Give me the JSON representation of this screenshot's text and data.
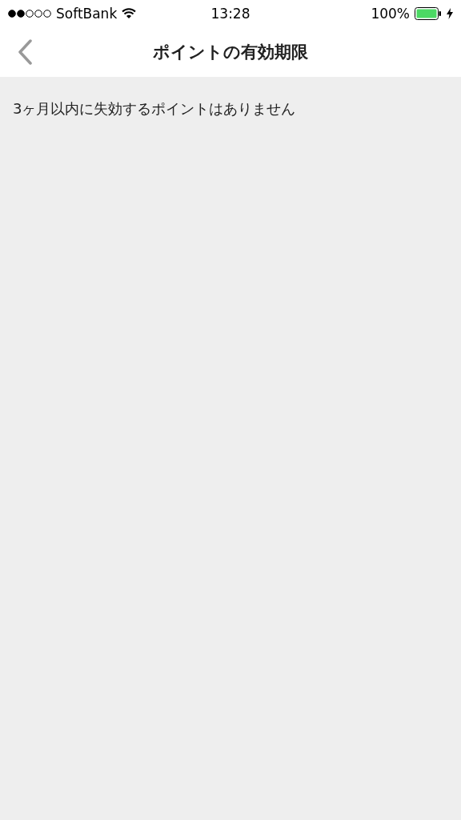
{
  "status_bar": {
    "carrier": "SoftBank",
    "time": "13:28",
    "battery": "100%"
  },
  "nav": {
    "title": "ポイントの有効期限"
  },
  "message": "3ヶ月以内に失効するポイントはありません"
}
